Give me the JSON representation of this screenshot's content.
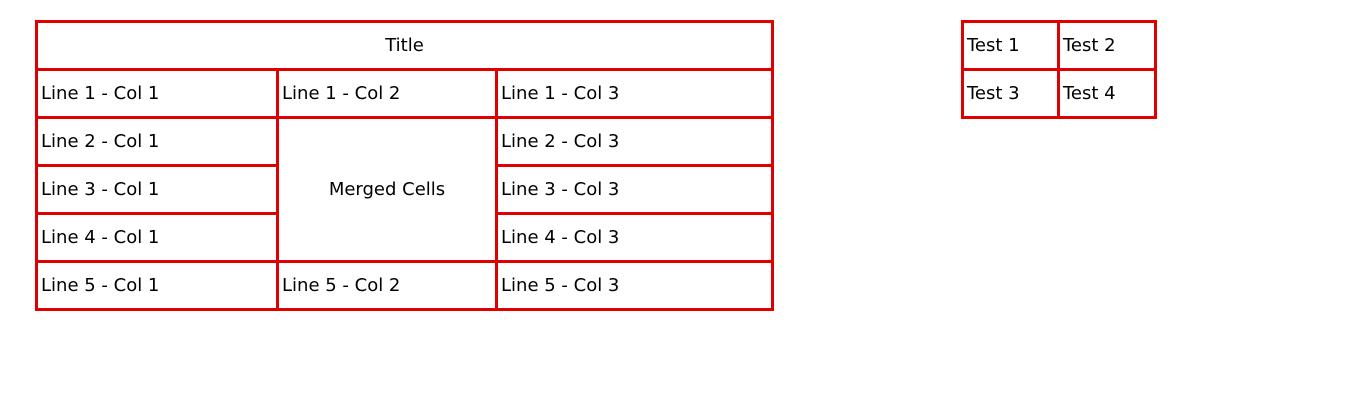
{
  "main_table": {
    "title": "Title",
    "rows": [
      [
        "Line 1 - Col 1",
        "Line 1 - Col 2",
        "Line 1 - Col 3"
      ],
      [
        "Line 2 - Col 1",
        "Merged Cells",
        "Line 2 - Col 3"
      ],
      [
        "Line 3 - Col 1",
        "",
        "Line 3 - Col 3"
      ],
      [
        "Line 4 - Col 1",
        "",
        "Line 4 - Col 3"
      ],
      [
        "Line 5 - Col 1",
        "Line 5 - Col 2",
        "Line 5 - Col 3"
      ]
    ]
  },
  "side_table": {
    "rows": [
      [
        "Test 1",
        "Test 2"
      ],
      [
        "Test 3",
        "Test 4"
      ]
    ]
  },
  "colors": {
    "border": "#e00000",
    "text": "#000000",
    "background": "#ffffff"
  }
}
